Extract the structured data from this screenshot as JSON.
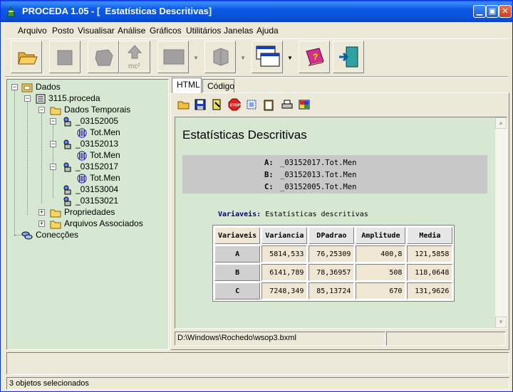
{
  "window": {
    "title": "PROCEDA 1.05 - [  Estatísticas Descritivas]",
    "accent": "#0a5ae6"
  },
  "menu": [
    "Arquivo",
    "Posto",
    "Visualisar",
    "Análise",
    "Gráficos",
    "Utilitários",
    "Janelas",
    "Ajuda"
  ],
  "toolbar": {
    "buttons": [
      "open-folder-icon",
      "stop-square-icon",
      "shape-icon",
      "mc2-icon",
      "rectangle-icon",
      "puzzle-icon",
      "windows-icon",
      "help-book-icon",
      "exit-door-icon"
    ],
    "mc2_label": "mc²"
  },
  "tree": {
    "root": "Dados",
    "project": "3115.proceda",
    "temporal": "Dados Temporais",
    "stations": [
      {
        "name": "_03152005",
        "child": "Tot.Men"
      },
      {
        "name": "_03152013",
        "child": "Tot.Men"
      },
      {
        "name": "_03152017",
        "child": "Tot.Men"
      },
      {
        "name": "_03153004"
      },
      {
        "name": "_03153021"
      }
    ],
    "properties": "Propriedades",
    "associated": "Arquivos Associados",
    "connections": "Conecções"
  },
  "tabs": [
    "HTML",
    "Código"
  ],
  "report": {
    "title": "Estatísticas Descritivas",
    "variables": [
      {
        "key": "A:",
        "value": "_03152017.Tot.Men"
      },
      {
        "key": "B:",
        "value": "_03152013.Tot.Men"
      },
      {
        "key": "C:",
        "value": "_03152005.Tot.Men"
      }
    ],
    "caption_label": "Variaveis:",
    "caption_text": " Estatísticas descritivas",
    "table": {
      "headers": [
        "Variaveis",
        "Variancia",
        "DPadrao",
        "Amplitude",
        "Media"
      ],
      "rows": [
        [
          "A",
          "5814,533",
          "76,25309",
          "400,8",
          "121,5858"
        ],
        [
          "B",
          "6141,789",
          "78,36957",
          "508",
          "118,0648"
        ],
        [
          "C",
          "7248,349",
          "85,13724",
          "670",
          "131,9626"
        ]
      ]
    }
  },
  "path": "D:\\Windows\\Rochedo\\wsop3.bxml",
  "status": "3 objetos selecionados"
}
